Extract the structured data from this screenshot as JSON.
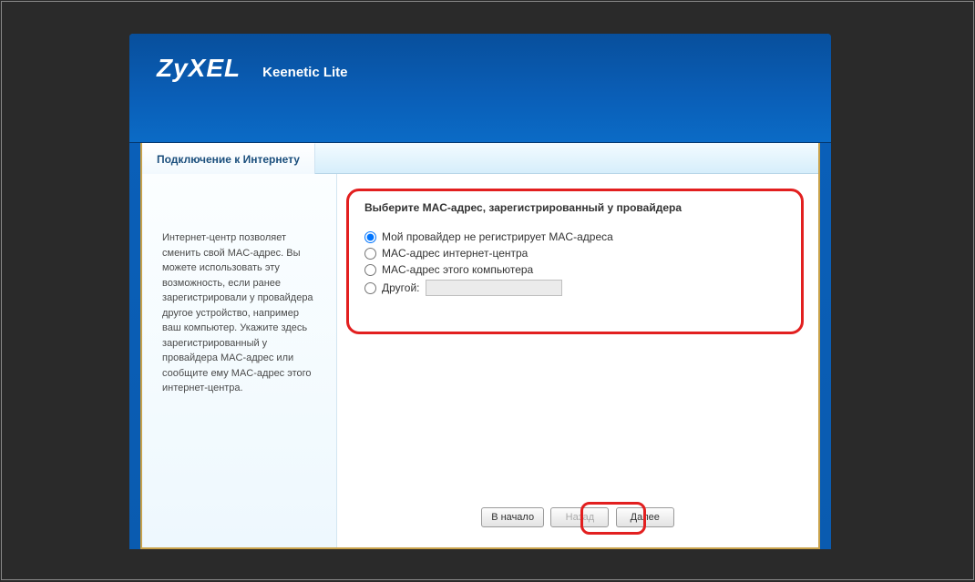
{
  "header": {
    "logo": "ZyXEL",
    "model": "Keenetic Lite"
  },
  "tab": {
    "title": "Подключение к Интернету"
  },
  "sidebar": {
    "text": "Интернет-центр позволяет сменить свой MAC-адрес. Вы можете использовать эту возможность, если ранее зарегистрировали у провайдера другое устройство, например ваш компьютер. Укажите здесь зарегистрированный у провайдера MAC-адрес или сообщите ему MAC-адрес этого интернет-центра."
  },
  "form": {
    "legend": "Выберите MAC-адрес, зарегистрированный у провайдера",
    "opt1": "Мой провайдер не регистрирует MAC-адреса",
    "opt2": "MAC-адрес интернет-центра",
    "opt3": "MAC-адрес этого компьютера",
    "opt4": "Другой:",
    "other_value": ""
  },
  "buttons": {
    "home": "В начало",
    "back": "Назад",
    "next": "Далее"
  }
}
